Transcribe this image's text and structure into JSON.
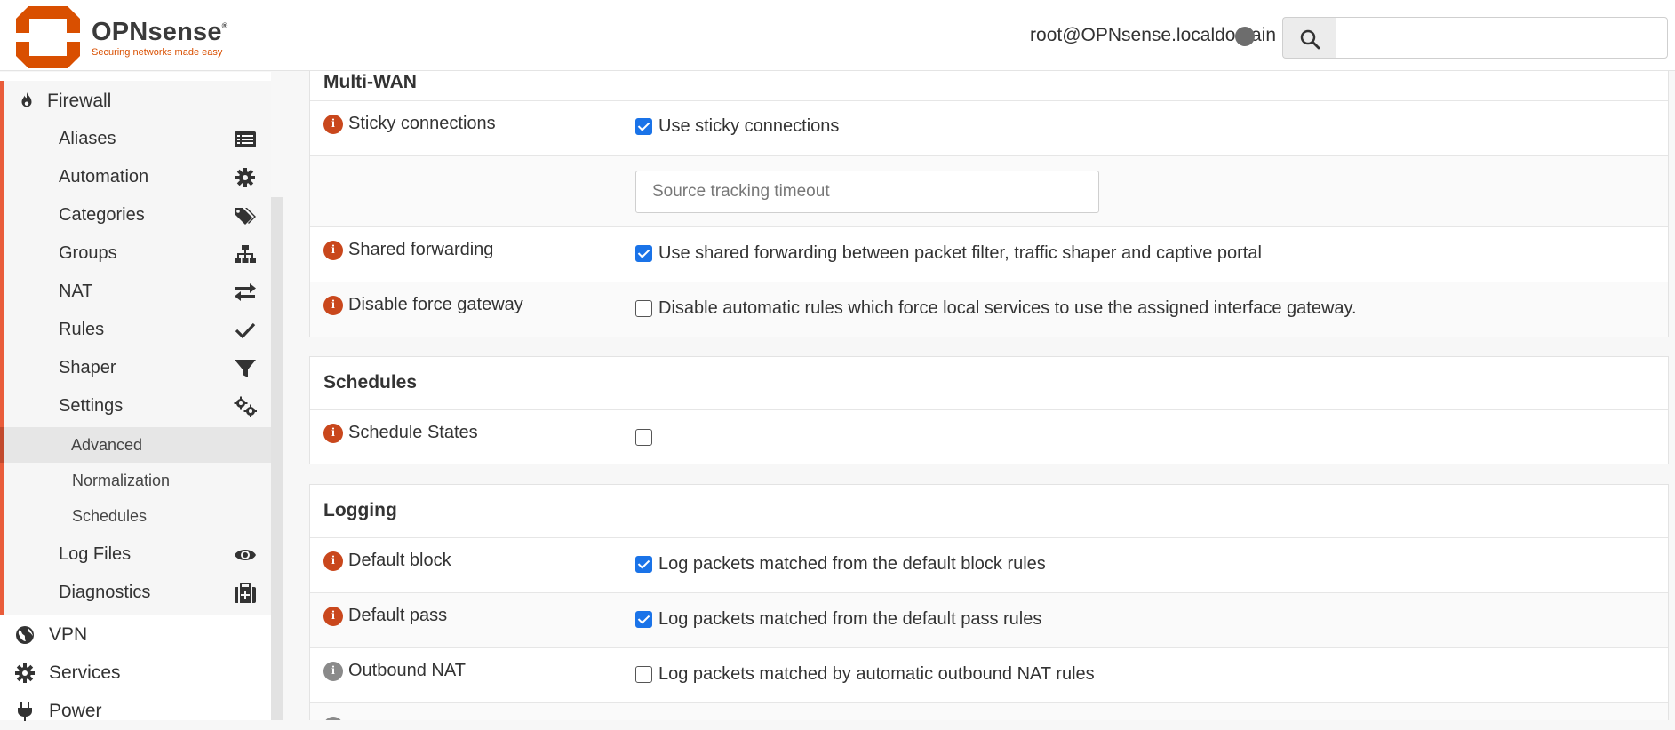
{
  "header": {
    "brand_name": "OPNsense",
    "brand_reg": "®",
    "brand_tagline": "Securing networks made easy",
    "user": "root@OPNsense.localdomain",
    "search_placeholder": ""
  },
  "sidebar": {
    "section": {
      "label": "Firewall",
      "icon": "flame-icon"
    },
    "items": [
      {
        "label": "Aliases",
        "icon": "list-icon"
      },
      {
        "label": "Automation",
        "icon": "gear-icon"
      },
      {
        "label": "Categories",
        "icon": "tags-icon"
      },
      {
        "label": "Groups",
        "icon": "sitemap-icon"
      },
      {
        "label": "NAT",
        "icon": "exchange-icon"
      },
      {
        "label": "Rules",
        "icon": "check-icon"
      },
      {
        "label": "Shaper",
        "icon": "filter-icon"
      },
      {
        "label": "Settings",
        "icon": "gears-icon"
      }
    ],
    "settings_sub": [
      {
        "label": "Advanced",
        "active": true
      },
      {
        "label": "Normalization",
        "active": false
      },
      {
        "label": "Schedules",
        "active": false
      }
    ],
    "items_after": [
      {
        "label": "Log Files",
        "icon": "eye-icon"
      },
      {
        "label": "Diagnostics",
        "icon": "medkit-icon"
      }
    ],
    "main": [
      {
        "label": "VPN",
        "icon": "globe-icon"
      },
      {
        "label": "Services",
        "icon": "gear-icon"
      },
      {
        "label": "Power",
        "icon": "plug-icon"
      }
    ]
  },
  "content": {
    "multiwan": {
      "title": "Multi-WAN",
      "sticky_label": "Sticky connections",
      "sticky_cb": "Use sticky connections",
      "sticky_checked": true,
      "timeout_placeholder": "Source tracking timeout",
      "shared_label": "Shared forwarding",
      "shared_cb": "Use shared forwarding between packet filter, traffic shaper and captive portal",
      "shared_checked": true,
      "force_label": "Disable force gateway",
      "force_cb": "Disable automatic rules which force local services to use the assigned interface gateway.",
      "force_checked": false
    },
    "schedules": {
      "title": "Schedules",
      "states_label": "Schedule States",
      "states_checked": false
    },
    "logging": {
      "title": "Logging",
      "block_label": "Default block",
      "block_cb": "Log packets matched from the default block rules",
      "block_checked": true,
      "pass_label": "Default pass",
      "pass_cb": "Log packets matched from the default pass rules",
      "pass_checked": true,
      "nat_label": "Outbound NAT",
      "nat_cb": "Log packets matched by automatic outbound NAT rules",
      "nat_checked": false
    }
  },
  "colors": {
    "accent": "#d94f00",
    "sidebar_marker": "#e95c3a",
    "checkbox_blue": "#1a73e8"
  }
}
